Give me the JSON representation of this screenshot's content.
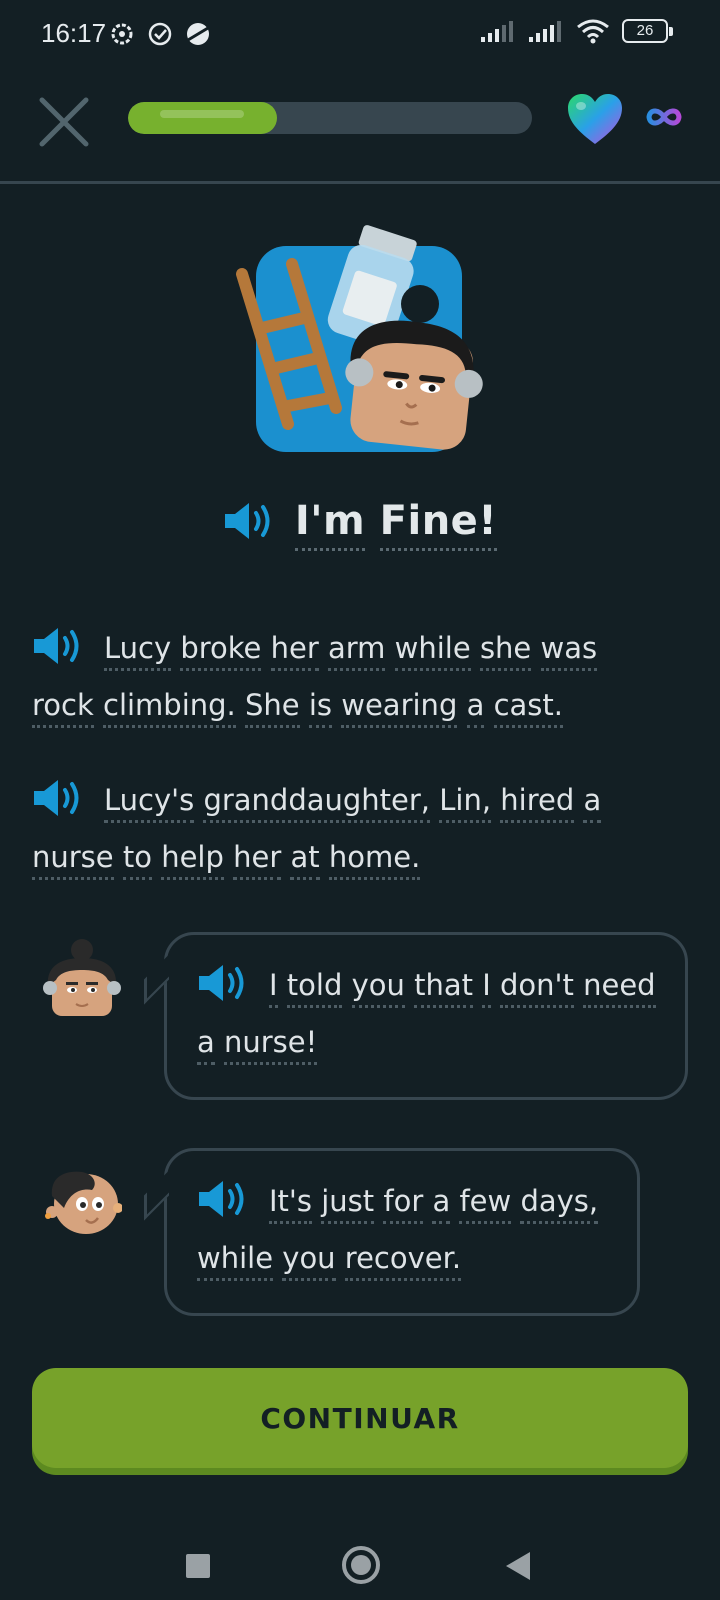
{
  "status_bar": {
    "time": "16:17",
    "battery": "26"
  },
  "lesson": {
    "progress": 0.37,
    "hearts": "∞"
  },
  "story": {
    "title_word_1": "I'm",
    "title_word_2": "Fine!",
    "narration_1": {
      "words": [
        "Lucy",
        "broke",
        "her",
        "arm",
        "while",
        "she",
        "was",
        "rock",
        "climbing.",
        "She",
        "is",
        "wearing",
        "a",
        "cast."
      ]
    },
    "narration_2": {
      "words": [
        "Lucy's",
        "granddaughter,",
        "Lin,",
        "hired",
        "a",
        "nurse",
        "to",
        "help",
        "her",
        "at",
        "home."
      ]
    },
    "dialogue_1": {
      "words": [
        "I",
        "told",
        "you",
        "that",
        "I",
        "don't",
        "need",
        "a",
        "nurse!"
      ]
    },
    "dialogue_2": {
      "words": [
        "It's",
        "just",
        "for",
        "a",
        "few",
        "days,",
        "while",
        "you",
        "recover."
      ]
    }
  },
  "actions": {
    "continue_label": "CONTINUAR"
  },
  "colors": {
    "background": "#131f24",
    "accent_green": "#77a22a",
    "speaker_blue": "#1899d6",
    "border": "#37464f"
  }
}
